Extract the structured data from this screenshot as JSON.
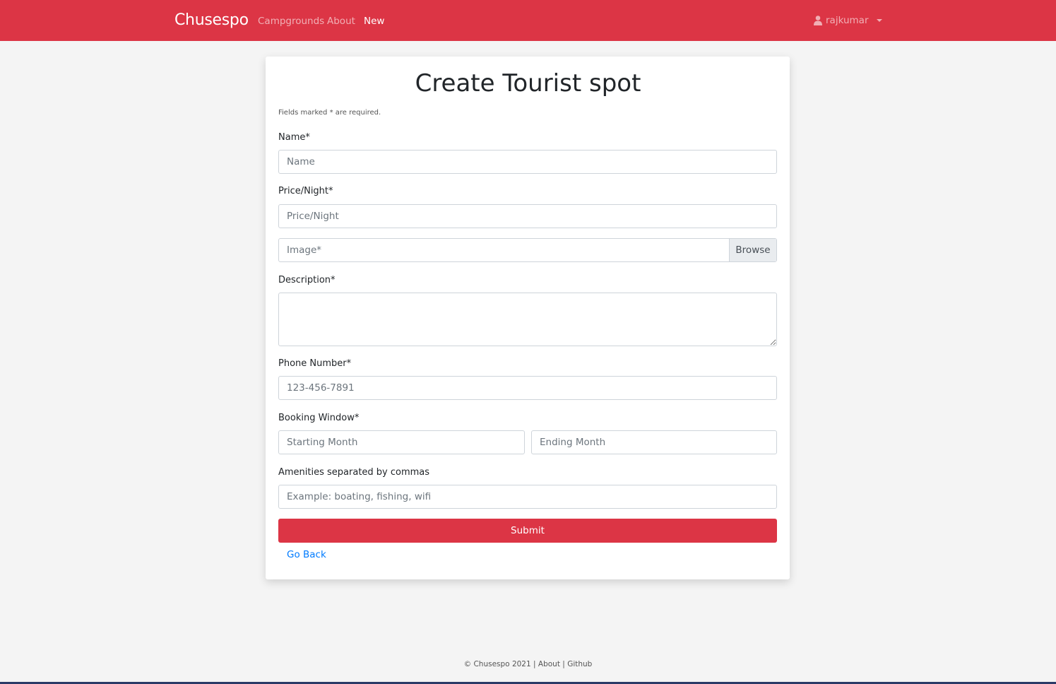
{
  "nav": {
    "brand": "Chusespo",
    "links": [
      "Campgrounds",
      "About",
      "New"
    ],
    "user": "rajkumar",
    "colors": {
      "bar": "#dc3545",
      "active": "#ffffff"
    }
  },
  "form": {
    "title": "Create Tourist spot",
    "note": "Fields marked * are required.",
    "name": {
      "label": "Name*",
      "placeholder": "Name"
    },
    "price": {
      "label": "Price/Night*",
      "placeholder": "Price/Night"
    },
    "image": {
      "label": "Image*",
      "browse": "Browse"
    },
    "description": {
      "label": "Description*"
    },
    "phone": {
      "label": "Phone Number*",
      "placeholder": "123-456-7891"
    },
    "booking": {
      "label": "Booking Window*",
      "start_placeholder": "Starting Month",
      "end_placeholder": "Ending Month"
    },
    "amenities": {
      "label": "Amenities separated by commas",
      "placeholder": "Example: boating, fishing, wifi"
    },
    "submit": "Submit",
    "go_back": "Go Back"
  },
  "footer": {
    "copyright": "© Chusespo 2021",
    "sep": "|",
    "about": "About",
    "github": "Github"
  }
}
